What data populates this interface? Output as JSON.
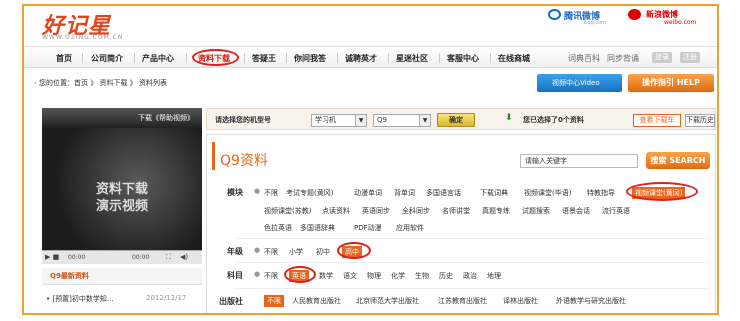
{
  "header": {
    "logo": "好记星",
    "url": "WWW.OZING.COM.CN",
    "weibo_tencent": "腾讯微博",
    "weibo_tencent_sub": "t.qq.com",
    "weibo_sina": "新浪微博",
    "weibo_sina_sub": "weibo.com"
  },
  "nav": {
    "items": [
      "首页",
      "公司简介",
      "产品中心",
      "资料下载",
      "答疑王",
      "你问我答",
      "诚聘英才",
      "星迷社区",
      "客服中心",
      "在线商城"
    ],
    "right": [
      "词典百科",
      "同步背诵"
    ],
    "login": "登录",
    "register": "注册"
  },
  "breadcrumb": "您的位置：首页 》 资料下载 》 资料列表",
  "buttons": {
    "video_center": "视频中心Video",
    "help": "操作指引 HELP",
    "download_video": "下载《帮助视频》",
    "confirm": "确定",
    "go_download": "查看下载车",
    "history": "下载历史"
  },
  "selector": {
    "label": "请选择您的机型号",
    "model_type": "学习机",
    "model": "Q9",
    "selected_text": "您已选择了0个资料"
  },
  "video": {
    "title1": "资料下载",
    "title2": "演示视频",
    "time_left": "00:00",
    "time_right": "00:00"
  },
  "sidebar": {
    "hot_title": "Q9最新资料",
    "news": [
      {
        "title": "[预置]初中数学知…",
        "date": "2012/12/17"
      }
    ]
  },
  "panel": {
    "title": "Q9资料",
    "search_value": "请输入关键字",
    "search_button": "搜索 SEARCH",
    "rows": [
      {
        "label": "模块",
        "line1": [
          "不限",
          "考试专题(黄冈)",
          "动漫单词",
          "背单词",
          "多国语言话",
          "下载词典",
          "视频课堂(毕语)",
          "特教指导"
        ],
        "selected": "视频课堂(黄冈)",
        "line2": [
          "视频课堂(苏教)",
          "点读资料",
          "英语同步",
          "全科同步",
          "名师讲堂",
          "真题专练",
          "试题搜索",
          "语景会话",
          "流行英语"
        ],
        "line3": [
          "色拉英语",
          "多国语辞典",
          "PDF动漫",
          "应用软件"
        ]
      },
      {
        "label": "年级",
        "options": [
          "不限",
          "小学",
          "初中"
        ],
        "selected": "高中"
      },
      {
        "label": "科目",
        "options_before": [
          "不限"
        ],
        "selected": "英语",
        "options": [
          "数学",
          "语文",
          "物理",
          "化学",
          "生物",
          "历史",
          "政治",
          "地理"
        ]
      },
      {
        "label": "出版社",
        "selected": "不限",
        "options": [
          "人民教育出版社",
          "北京师范大学出版社",
          "江苏教育出版社",
          "译林出版社",
          "外语教学与研究出版社"
        ]
      }
    ]
  },
  "colors": {
    "accent": "#e8661b",
    "circle": "#e02020",
    "border": "#f0a030"
  }
}
